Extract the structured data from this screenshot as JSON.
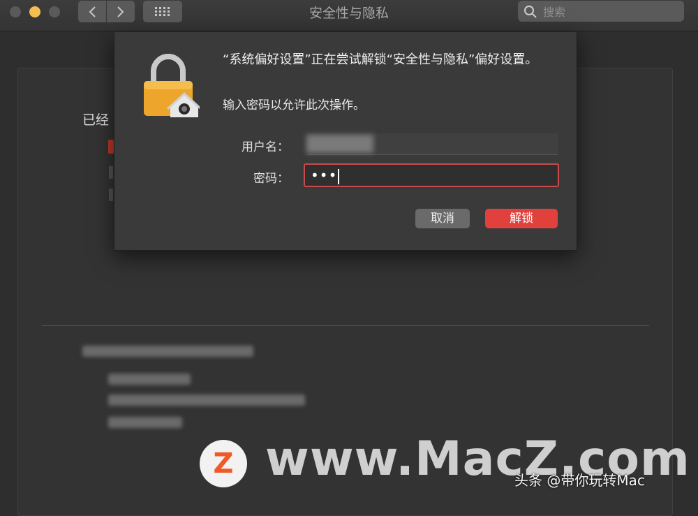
{
  "window": {
    "title": "安全性与隐私",
    "search_placeholder": "搜索"
  },
  "background": {
    "partial_text": "已经"
  },
  "dialog": {
    "message": "“系统偏好设置”正在尝试解锁“安全性与隐私”偏好设置。",
    "sub_message": "输入密码以允许此次操作。",
    "username_label": "用户名：",
    "password_label": "密码：",
    "password_value": "•••",
    "cancel_label": "取消",
    "unlock_label": "解锁"
  },
  "watermark": {
    "logo_letter": "Z",
    "site": "www.MacZ.com",
    "credit": "头条 @带你玩转Mac"
  },
  "colors": {
    "accent_red": "#e0413d",
    "focus_border": "#c94a4a",
    "traffic_light_yellow": "#f4bf4f",
    "logo_orange": "#f05a28"
  }
}
